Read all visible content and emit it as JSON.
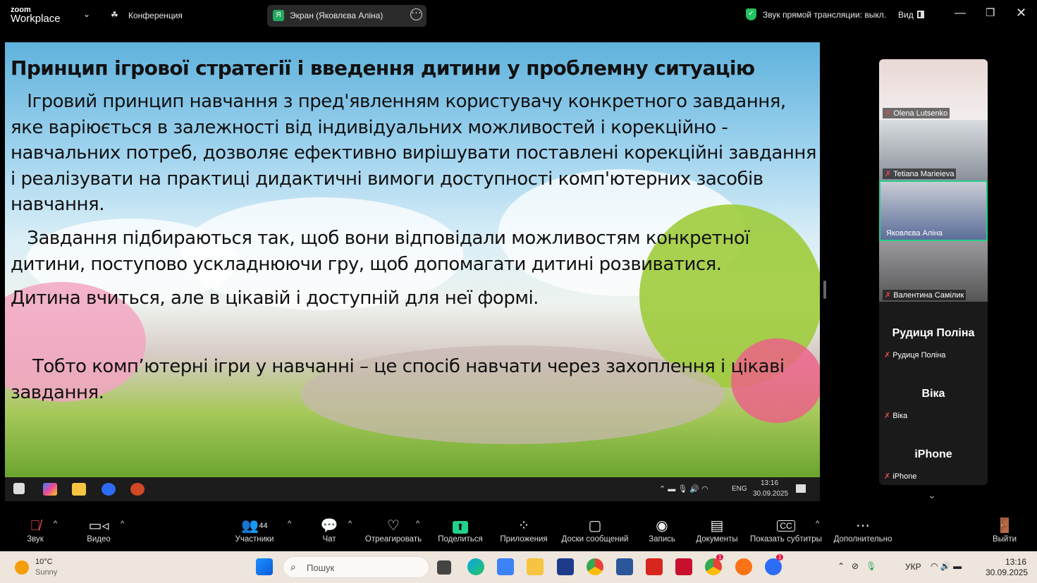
{
  "topbar": {
    "logo_small": "zoom",
    "logo_big": "Workplace",
    "meeting_label": "Конференция",
    "share_badge": "Я",
    "share_label": "Экран (Яковлєва Аліна)",
    "audio_status": "Звук прямой трансляции: выкл.",
    "view_label": "Вид"
  },
  "slide": {
    "title": "Принцип ігрової стратегії і введення дитини у проблемну ситуацію",
    "p1": "   Ігровий принцип навчання з пред'явленням користувачу конкретного завдання, яке варіюється в залежності від індивідуальних можливостей і корекційно - навчальних потреб, дозволяє ефективно вирішувати поставлені корекційні завдання і реалізувати на практиці дидактичні вимоги доступності комп'ютерних засобів навчання.",
    "p2": "   Завдання підбираються так, щоб вони відповідали можливостям конкретної дитини, поступово ускладнюючи гру, щоб допомагати дитині розвиватися.",
    "p3": "Дитина вчиться, але в цікавій і доступній для неї формі.",
    "p4": "    Тобто комп’ютерні ігри у навчанні – це спосіб навчати через захоплення і цікаві завдання."
  },
  "inner_taskbar": {
    "lang": "ENG",
    "time": "13:16",
    "date": "30.09.2025"
  },
  "participants": [
    {
      "name": "Olena Lutsenko",
      "video": true
    },
    {
      "name": "Tetiana Marieieva",
      "video": true
    },
    {
      "name": "Яковлєва Аліна",
      "video": true,
      "active": true
    },
    {
      "name": "Валентина Самілик",
      "video": true
    },
    {
      "name": "Рудиця Поліна",
      "video": false
    },
    {
      "name": "Віка",
      "video": false
    },
    {
      "name": "iPhone",
      "video": false
    }
  ],
  "toolbar": {
    "audio": "Звук",
    "video": "Видео",
    "participants": "Участники",
    "participants_count": "44",
    "chat": "Чат",
    "react": "Отреагировать",
    "share": "Поделиться",
    "apps": "Приложения",
    "whiteboards": "Доски сообщений",
    "record": "Запись",
    "docs": "Документы",
    "captions": "Показать субтитры",
    "more": "Дополнительно",
    "leave": "Выйти"
  },
  "taskbar": {
    "temp": "10°C",
    "weather": "Sunny",
    "search_placeholder": "Пошук",
    "lang": "УКР",
    "time": "13:16",
    "date": "30.09.2025",
    "badge_chrome": "1",
    "badge_zoom": "1"
  },
  "colors": {
    "accent_green": "#23d18b",
    "mute_red": "#e5484d"
  }
}
